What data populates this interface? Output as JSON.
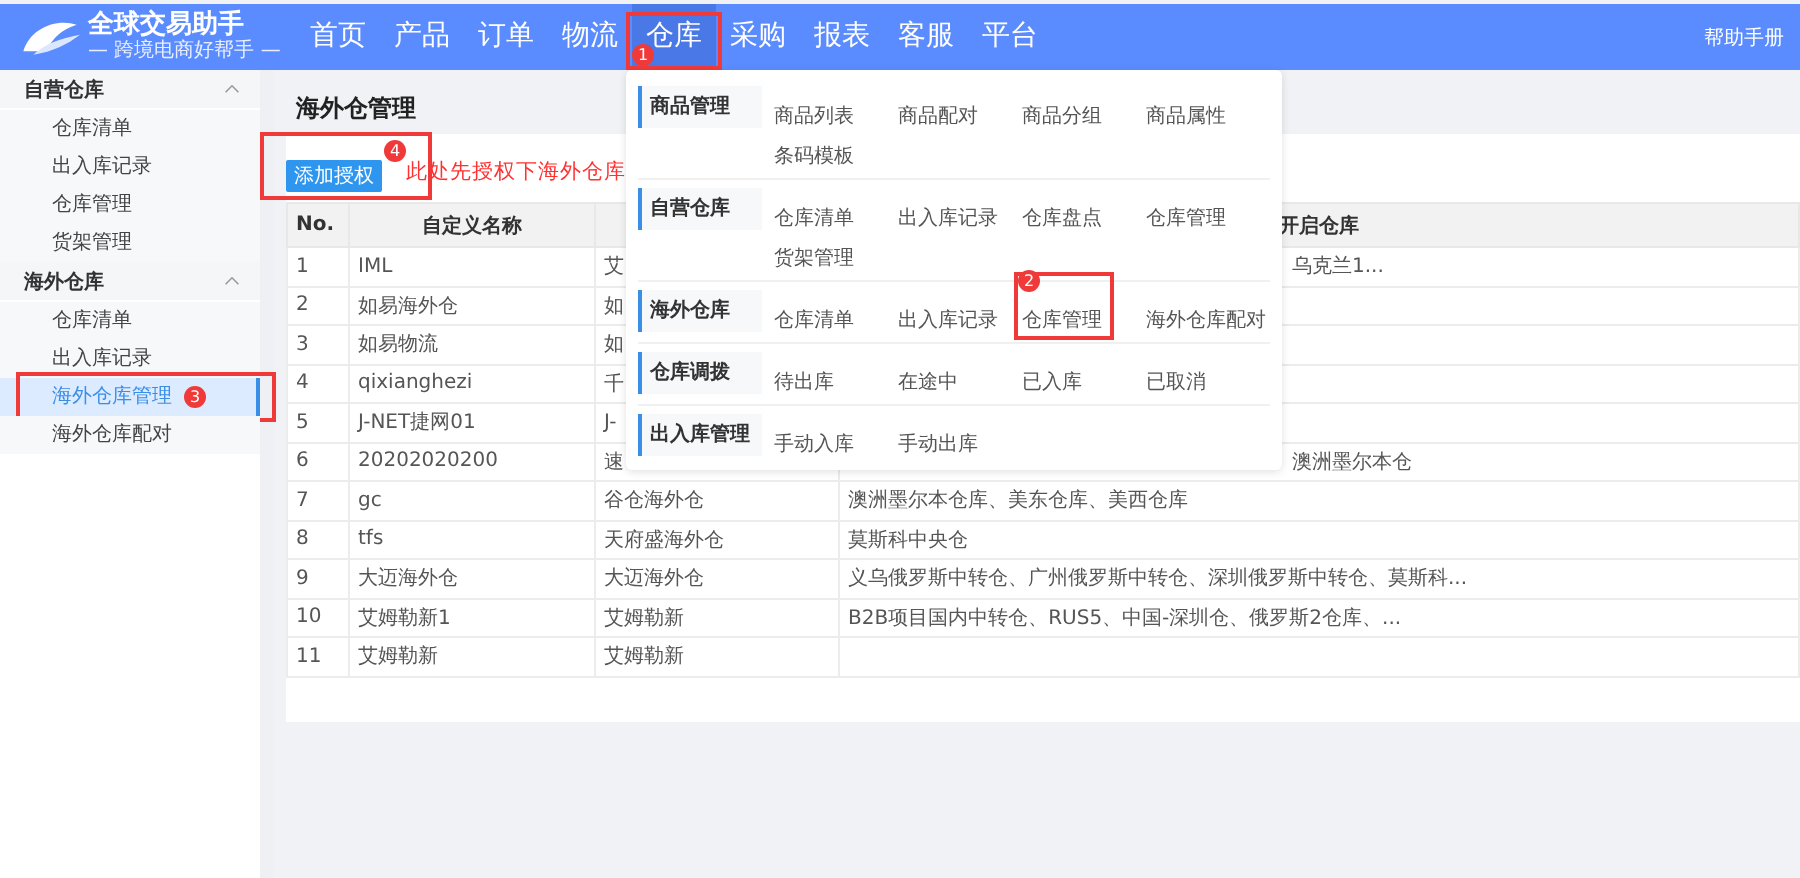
{
  "logo": {
    "title": "全球交易助手",
    "subtitle": "— 跨境电商好帮手 —"
  },
  "nav": [
    {
      "label": "首页",
      "selected": false
    },
    {
      "label": "产品",
      "selected": false
    },
    {
      "label": "订单",
      "selected": false
    },
    {
      "label": "物流",
      "selected": false
    },
    {
      "label": "仓库",
      "selected": true,
      "callout": "1"
    },
    {
      "label": "采购",
      "selected": false
    },
    {
      "label": "报表",
      "selected": false
    },
    {
      "label": "客服",
      "selected": false
    },
    {
      "label": "平台",
      "selected": false
    }
  ],
  "help_link": "帮助手册",
  "sidebar": [
    {
      "label": "自营仓库",
      "expanded": true,
      "children": [
        {
          "label": "仓库清单",
          "selected": false
        },
        {
          "label": "出入库记录",
          "selected": false
        },
        {
          "label": "仓库管理",
          "selected": false
        },
        {
          "label": "货架管理",
          "selected": false
        }
      ]
    },
    {
      "label": "海外仓库",
      "expanded": true,
      "children": [
        {
          "label": "仓库清单",
          "selected": false
        },
        {
          "label": "出入库记录",
          "selected": false
        },
        {
          "label": "海外仓库管理",
          "selected": true,
          "callout": "3"
        },
        {
          "label": "海外仓库配对",
          "selected": false
        }
      ]
    }
  ],
  "page_title": "海外仓管理",
  "add_button": {
    "label": "添加授权",
    "callout": "4"
  },
  "note": "此处先授权下海外仓库",
  "table": {
    "columns": [
      "No.",
      "自定义名称",
      "",
      "开启仓库"
    ],
    "rows": [
      [
        "1",
        "IML",
        "艾",
        "乌克兰1..."
      ],
      [
        "2",
        "如易海外仓",
        "如",
        ""
      ],
      [
        "3",
        "如易物流",
        "如",
        ""
      ],
      [
        "4",
        "qixianghezi",
        "千",
        ""
      ],
      [
        "5",
        "J-NET捷网01",
        "J-",
        ""
      ],
      [
        "6",
        "20202020200",
        "速",
        "澳洲墨尔本仓"
      ],
      [
        "7",
        "gc",
        "谷仓海外仓",
        "澳洲墨尔本仓库、美东仓库、美西仓库"
      ],
      [
        "8",
        "tfs",
        "天府盛海外仓",
        "莫斯科中央仓"
      ],
      [
        "9",
        "大迈海外仓",
        "大迈海外仓",
        "义乌俄罗斯中转仓、广州俄罗斯中转仓、深圳俄罗斯中转仓、莫斯科..."
      ],
      [
        "10",
        "艾姆勒新1",
        "艾姆勒新",
        "B2B项目国内中转仓、RUS5、中国-深圳仓、俄罗斯2仓库、..."
      ],
      [
        "11",
        "艾姆勒新",
        "艾姆勒新",
        ""
      ]
    ]
  },
  "dropdown": [
    {
      "category": "商品管理",
      "items": [
        {
          "label": "商品列表"
        },
        {
          "label": "商品配对"
        },
        {
          "label": "商品分组"
        },
        {
          "label": "商品属性"
        },
        {
          "label": "条码模板"
        }
      ]
    },
    {
      "category": "自营仓库",
      "items": [
        {
          "label": "仓库清单"
        },
        {
          "label": "出入库记录"
        },
        {
          "label": "仓库盘点"
        },
        {
          "label": "仓库管理"
        },
        {
          "label": "货架管理"
        }
      ]
    },
    {
      "category": "海外仓库",
      "items": [
        {
          "label": "仓库清单"
        },
        {
          "label": "出入库记录"
        },
        {
          "label": "仓库管理",
          "callout": "2"
        },
        {
          "label": "海外仓库配对"
        }
      ]
    },
    {
      "category": "仓库调拨",
      "items": [
        {
          "label": "待出库"
        },
        {
          "label": "在途中"
        },
        {
          "label": "已入库"
        },
        {
          "label": "已取消"
        }
      ]
    },
    {
      "category": "出入库管理",
      "items": [
        {
          "label": "手动入库"
        },
        {
          "label": "手动出库"
        }
      ]
    }
  ]
}
